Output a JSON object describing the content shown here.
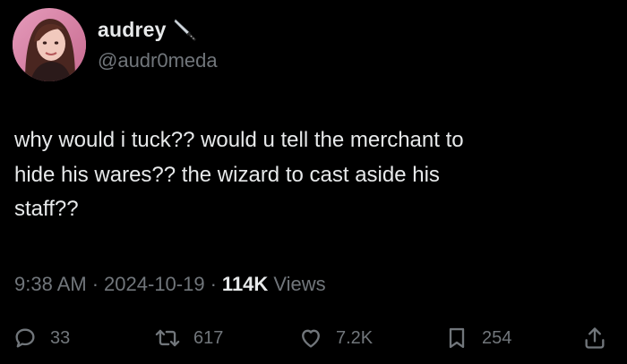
{
  "author": {
    "display_name": "audrey",
    "handle": "@audr0meda",
    "name_emoji_icon": "knife-icon"
  },
  "tweet": {
    "text": "why would i tuck?? would u tell the merchant to\nhide his wares?? the wizard to cast aside his\nstaff??"
  },
  "meta": {
    "time": "9:38 AM",
    "separator1": "·",
    "date": "2024-10-19",
    "separator2": "·",
    "views_count": "114K",
    "views_label": "Views"
  },
  "actions": {
    "replies": "33",
    "retweets": "617",
    "likes": "7.2K",
    "bookmarks": "254"
  },
  "colors": {
    "background": "#000000",
    "primary_text": "#e7e9ea",
    "secondary_text": "#71767b"
  }
}
